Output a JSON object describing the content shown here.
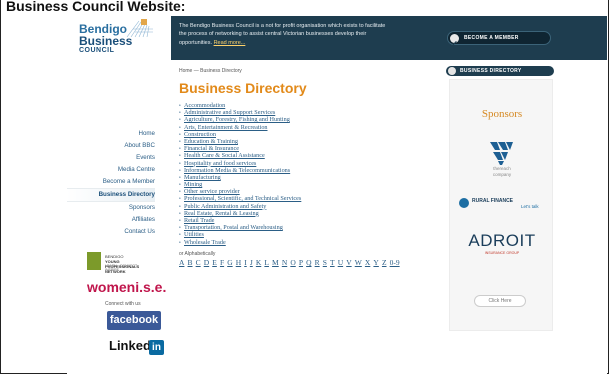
{
  "page_title": "Business Council Website:",
  "logo": {
    "line1": "Bendigo",
    "line2": "Business",
    "line3": "COUNCIL"
  },
  "header": {
    "intro_text": "The Bendigo Business Council is a not for profit organisation which exists to facilitate the process of networking to assist central Victorian businesses develop their opportunities.",
    "read_more": "Read more...",
    "become_member": "BECOME A MEMBER"
  },
  "nav": {
    "items": [
      {
        "label": "Home"
      },
      {
        "label": "About BBC"
      },
      {
        "label": "Events"
      },
      {
        "label": "Media Centre"
      },
      {
        "label": "Become a Member"
      },
      {
        "label": "Business Directory"
      },
      {
        "label": "Sponsors"
      },
      {
        "label": "Affiliates"
      },
      {
        "label": "Contact Us"
      }
    ]
  },
  "partners": {
    "ypn_line1": "BENDIGO",
    "ypn_line2": "YOUNG PROFESSIONALS NETWORK",
    "ypn_line3": "LEARN · CONNECT · INSPIRE",
    "women": "womeni.s.e.",
    "connect": "Connect with us",
    "facebook": "facebook",
    "linkedin": "Linked",
    "linkedin_in": "in"
  },
  "main": {
    "breadcrumb": "Home — Business Directory",
    "title": "Business Directory",
    "categories": [
      "Accommodation",
      "Administrative and Support Services",
      "Agriculture, Forestry, Fishing and Hunting",
      "Arts, Entertainment & Recreation",
      "Construction",
      "Education & Training",
      "Financial & Insurance",
      "Health Care & Social Assistance",
      "Hospitality and food services",
      "Information Media & Telecommunications",
      "Manufacturing",
      "Mining",
      "Other service provider",
      "Professional, Scientific, and Technical Services",
      "Public Administration and Safety",
      "Real Estate, Rental & Leasing",
      "Retail Trade",
      "Transportation, Postal and Warehousing",
      "Utilities",
      "Wholesale Trade"
    ],
    "alpha_label": "or Alphabetically",
    "alphabet": [
      "A",
      "B",
      "C",
      "D",
      "E",
      "F",
      "G",
      "H",
      "I",
      "J",
      "K",
      "L",
      "M",
      "N",
      "O",
      "P",
      "Q",
      "R",
      "S",
      "T",
      "U",
      "V",
      "W",
      "X",
      "Y",
      "Z",
      "0-9"
    ]
  },
  "sidebar": {
    "heading": "BUSINESS DIRECTORY",
    "sponsors": "Sponsors",
    "reach_line1": "thereach",
    "reach_line2": "company",
    "rural_line1": "RURAL FINANCE",
    "rural_line2": "Let's talk",
    "adroit": "ADROIT",
    "adroit_sub": "INSURANCE GROUP",
    "click_here": "Click Here"
  },
  "colors": {
    "header_bg": "#1e3d4f",
    "title_orange": "#e28a1a",
    "link_blue": "#2b5e86"
  }
}
